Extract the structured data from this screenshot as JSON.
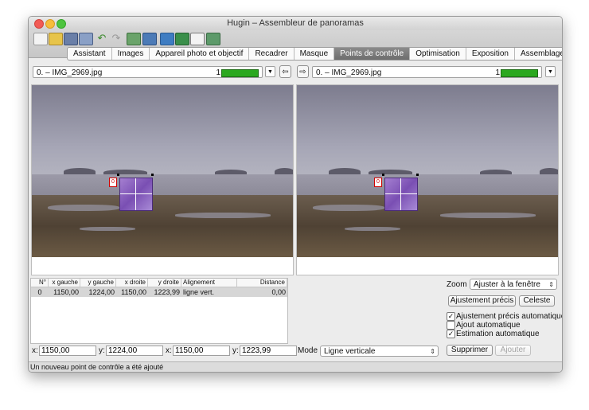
{
  "window": {
    "title": "Hugin – Assembleur de panoramas"
  },
  "tabs": [
    {
      "label": "Assistant",
      "active": false
    },
    {
      "label": "Images",
      "active": false
    },
    {
      "label": "Appareil photo et objectif",
      "active": false
    },
    {
      "label": "Recadrer",
      "active": false
    },
    {
      "label": "Masque",
      "active": false
    },
    {
      "label": "Points de contrôle",
      "active": true
    },
    {
      "label": "Optimisation",
      "active": false
    },
    {
      "label": "Exposition",
      "active": false
    },
    {
      "label": "Assemblage",
      "active": false
    }
  ],
  "left_image": {
    "name": "0. – IMG_2969.jpg",
    "count": "1",
    "progress": 1.0
  },
  "right_image": {
    "name": "0. – IMG_2969.jpg",
    "count": "1",
    "progress": 1.0
  },
  "point_marker": "0",
  "table": {
    "headers": [
      "N°",
      "x gauche",
      "y gauche",
      "x droite",
      "y droite",
      "Alignement",
      "Distance"
    ],
    "rows": [
      [
        "0",
        "1150,00",
        "1224,00",
        "1150,00",
        "1223,99",
        "ligne vert.",
        "0,00"
      ]
    ]
  },
  "coords": {
    "x_label": "x:",
    "y_label": "y:",
    "x_left": "1150,00",
    "y_left": "1224,00",
    "x_right": "1150,00",
    "y_right": "1223,99"
  },
  "mode": {
    "label": "Mode :",
    "value": "Ligne verticale"
  },
  "zoom": {
    "label": "Zoom :",
    "value": "Ajuster à la fenêtre"
  },
  "buttons": {
    "fine_tune": "Ajustement précis",
    "celeste": "Celeste",
    "delete": "Supprimer",
    "add": "Ajouter"
  },
  "checkboxes": [
    {
      "label": "Ajustement précis automatique",
      "checked": true
    },
    {
      "label": "Ajout automatique",
      "checked": false
    },
    {
      "label": "Estimation automatique",
      "checked": true
    }
  ],
  "status": "Un nouveau point de contrôle a été ajouté",
  "colors": {
    "progress": "#2aa81e",
    "active_tab": "#7a7a7a",
    "marker": "#d10000"
  }
}
